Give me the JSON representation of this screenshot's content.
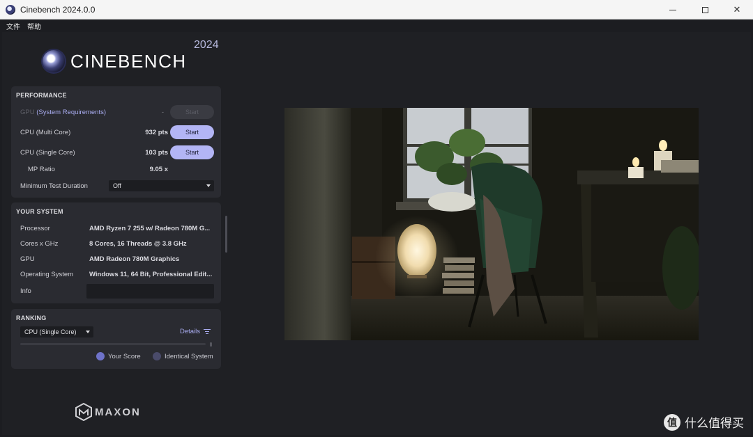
{
  "window": {
    "title": "Cinebench 2024.0.0",
    "minimize": "",
    "maximize": "",
    "close": "✕"
  },
  "menu": {
    "items": [
      "文件",
      "帮助"
    ]
  },
  "brand": {
    "name": "CINEBENCH",
    "year": "2024",
    "vendor": "MAXON"
  },
  "performance": {
    "title": "PERFORMANCE",
    "gpu": {
      "label_prefix": "GPU",
      "label_link": "(System Requirements)",
      "value": "-",
      "button": "Start"
    },
    "cpu_multi": {
      "label": "CPU (Multi Core)",
      "value": "932 pts",
      "button": "Start"
    },
    "cpu_single": {
      "label": "CPU (Single Core)",
      "value": "103 pts",
      "button": "Start"
    },
    "mp_ratio": {
      "label": "MP Ratio",
      "value": "9.05 x"
    },
    "min_duration": {
      "label": "Minimum Test Duration",
      "selected": "Off"
    }
  },
  "your_system": {
    "title": "YOUR SYSTEM",
    "rows": [
      {
        "label": "Processor",
        "value": "AMD Ryzen 7 255 w/ Radeon 780M G..."
      },
      {
        "label": "Cores x GHz",
        "value": "8 Cores, 16 Threads @ 3.8 GHz"
      },
      {
        "label": "GPU",
        "value": "AMD Radeon 780M Graphics"
      },
      {
        "label": "Operating System",
        "value": "Windows 11, 64 Bit, Professional Edit..."
      },
      {
        "label": "Info",
        "value": ""
      }
    ]
  },
  "ranking": {
    "title": "RANKING",
    "selected": "CPU (Single Core)",
    "details": "Details",
    "legend": [
      {
        "label": "Your Score",
        "color": "#6e72c9"
      },
      {
        "label": "Identical System",
        "color": "#4a4b6a"
      }
    ]
  },
  "colors": {
    "accent": "#b3b5f5",
    "panel": "#2a2b31",
    "background": "#1f2024"
  },
  "watermark": {
    "glyph": "值",
    "text": "什么值得买"
  }
}
